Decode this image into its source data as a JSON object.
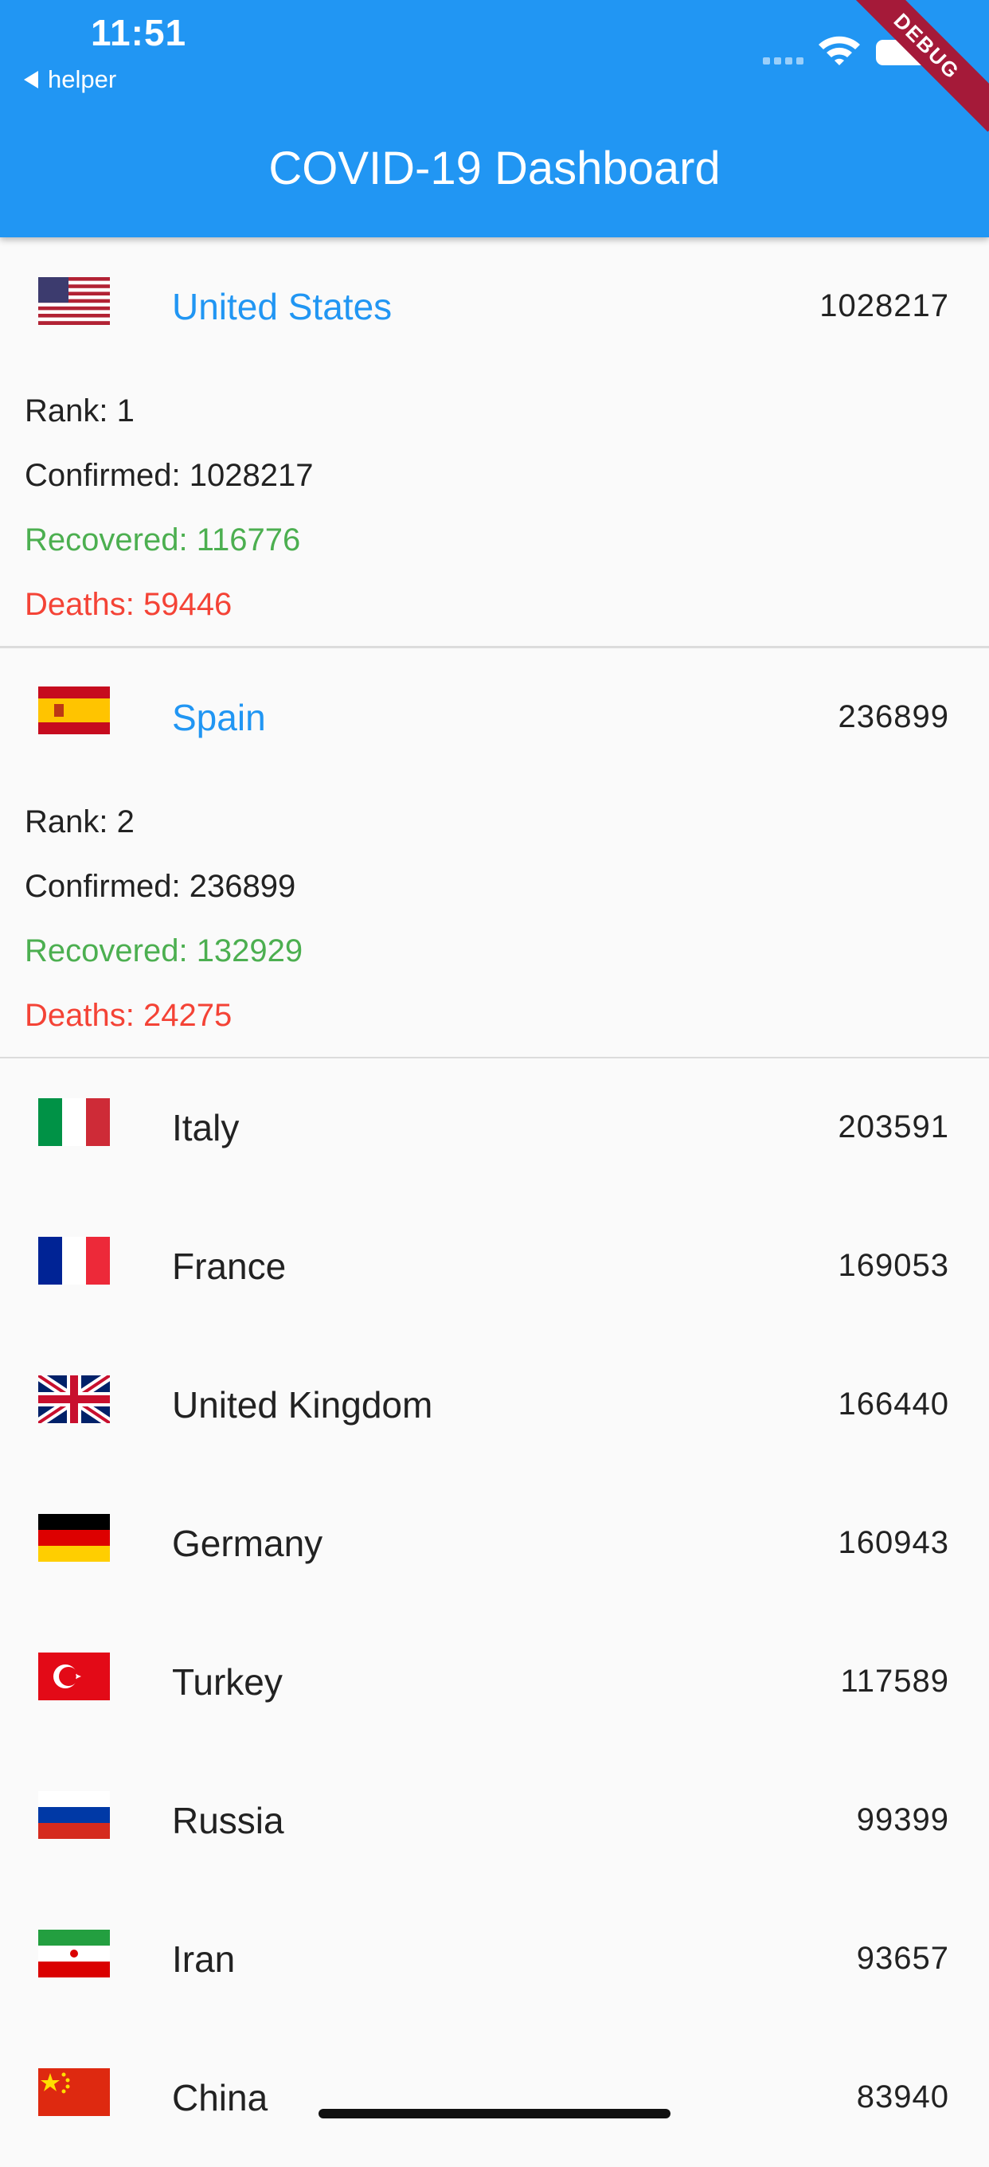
{
  "status": {
    "time": "11:51",
    "back_app": "helper"
  },
  "appbar": {
    "title": "COVID-19 Dashboard",
    "color": "#2196f3",
    "debug_banner": "DEBUG"
  },
  "labels": {
    "rank": "Rank:",
    "confirmed": "Confirmed:",
    "recovered": "Recovered:",
    "deaths": "Deaths:"
  },
  "countries": [
    {
      "name": "United States",
      "count": "1028217",
      "rank": "1",
      "confirmed": "1028217",
      "recovered": "116776",
      "deaths": "59446",
      "flag": "us-flag-icon",
      "expanded": true
    },
    {
      "name": "Spain",
      "count": "236899",
      "rank": "2",
      "confirmed": "236899",
      "recovered": "132929",
      "deaths": "24275",
      "flag": "spain-flag-icon",
      "expanded": true
    },
    {
      "name": "Italy",
      "count": "203591",
      "flag": "italy-flag-icon"
    },
    {
      "name": "France",
      "count": "169053",
      "flag": "france-flag-icon"
    },
    {
      "name": "United Kingdom",
      "count": "166440",
      "flag": "uk-flag-icon"
    },
    {
      "name": "Germany",
      "count": "160943",
      "flag": "germany-flag-icon"
    },
    {
      "name": "Turkey",
      "count": "117589",
      "flag": "turkey-flag-icon"
    },
    {
      "name": "Russia",
      "count": "99399",
      "flag": "russia-flag-icon"
    },
    {
      "name": "Iran",
      "count": "93657",
      "flag": "iran-flag-icon"
    },
    {
      "name": "China",
      "count": "83940",
      "flag": "china-flag-icon"
    }
  ]
}
